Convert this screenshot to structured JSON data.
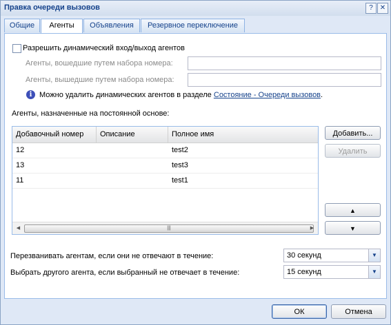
{
  "window": {
    "title": "Правка очереди вызовов"
  },
  "tabs": [
    {
      "label": "Общие"
    },
    {
      "label": "Агенты"
    },
    {
      "label": "Объявления"
    },
    {
      "label": "Резервное переключение"
    }
  ],
  "dynamic": {
    "checkbox_label": "Разрешить динамический вход/выход агентов",
    "checked": false,
    "login_label": "Агенты, вошедшие путем набора номера:",
    "login_value": "",
    "logout_label": "Агенты, вышедшие путем набора номера:",
    "logout_value": "",
    "info_text": "Можно удалить динамических агентов в разделе ",
    "info_link": "Состояние - Очереди вызовов",
    "info_suffix": "."
  },
  "static_agents": {
    "label": "Агенты, назначенные на постоянной основе:",
    "columns": [
      "Добавочный номер",
      "Описание",
      "Полное имя"
    ],
    "rows": [
      {
        "ext": "12",
        "desc": "",
        "name": "test2"
      },
      {
        "ext": "13",
        "desc": "",
        "name": "test3"
      },
      {
        "ext": "11",
        "desc": "",
        "name": "test1"
      }
    ],
    "add_button": "Добавить...",
    "delete_button": "Удалить"
  },
  "ring": {
    "label": "Перезванивать агентам, если они не отвечают в течение:",
    "value": "30 секунд"
  },
  "next_agent": {
    "label": "Выбрать другого агента, если выбранный не отвечает в течение:",
    "value": "15 секунд"
  },
  "footer": {
    "ok": "ОК",
    "cancel": "Отмена"
  }
}
